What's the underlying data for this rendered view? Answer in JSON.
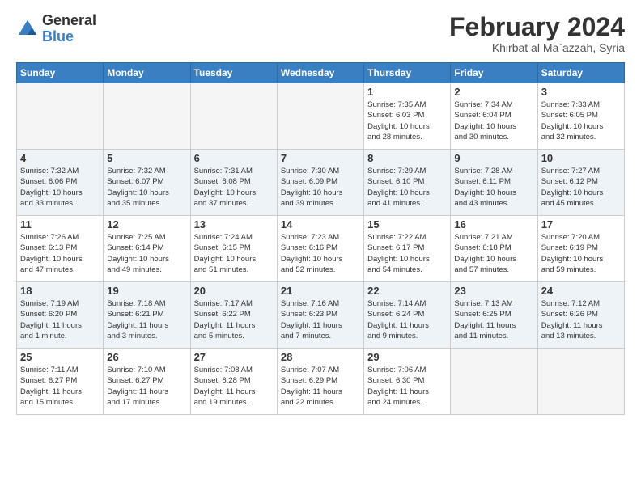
{
  "header": {
    "logo_general": "General",
    "logo_blue": "Blue",
    "title": "February 2024",
    "location": "Khirbat al Ma`azzah, Syria"
  },
  "weekdays": [
    "Sunday",
    "Monday",
    "Tuesday",
    "Wednesday",
    "Thursday",
    "Friday",
    "Saturday"
  ],
  "weeks": [
    [
      {
        "day": "",
        "info": ""
      },
      {
        "day": "",
        "info": ""
      },
      {
        "day": "",
        "info": ""
      },
      {
        "day": "",
        "info": ""
      },
      {
        "day": "1",
        "info": "Sunrise: 7:35 AM\nSunset: 6:03 PM\nDaylight: 10 hours\nand 28 minutes."
      },
      {
        "day": "2",
        "info": "Sunrise: 7:34 AM\nSunset: 6:04 PM\nDaylight: 10 hours\nand 30 minutes."
      },
      {
        "day": "3",
        "info": "Sunrise: 7:33 AM\nSunset: 6:05 PM\nDaylight: 10 hours\nand 32 minutes."
      }
    ],
    [
      {
        "day": "4",
        "info": "Sunrise: 7:32 AM\nSunset: 6:06 PM\nDaylight: 10 hours\nand 33 minutes."
      },
      {
        "day": "5",
        "info": "Sunrise: 7:32 AM\nSunset: 6:07 PM\nDaylight: 10 hours\nand 35 minutes."
      },
      {
        "day": "6",
        "info": "Sunrise: 7:31 AM\nSunset: 6:08 PM\nDaylight: 10 hours\nand 37 minutes."
      },
      {
        "day": "7",
        "info": "Sunrise: 7:30 AM\nSunset: 6:09 PM\nDaylight: 10 hours\nand 39 minutes."
      },
      {
        "day": "8",
        "info": "Sunrise: 7:29 AM\nSunset: 6:10 PM\nDaylight: 10 hours\nand 41 minutes."
      },
      {
        "day": "9",
        "info": "Sunrise: 7:28 AM\nSunset: 6:11 PM\nDaylight: 10 hours\nand 43 minutes."
      },
      {
        "day": "10",
        "info": "Sunrise: 7:27 AM\nSunset: 6:12 PM\nDaylight: 10 hours\nand 45 minutes."
      }
    ],
    [
      {
        "day": "11",
        "info": "Sunrise: 7:26 AM\nSunset: 6:13 PM\nDaylight: 10 hours\nand 47 minutes."
      },
      {
        "day": "12",
        "info": "Sunrise: 7:25 AM\nSunset: 6:14 PM\nDaylight: 10 hours\nand 49 minutes."
      },
      {
        "day": "13",
        "info": "Sunrise: 7:24 AM\nSunset: 6:15 PM\nDaylight: 10 hours\nand 51 minutes."
      },
      {
        "day": "14",
        "info": "Sunrise: 7:23 AM\nSunset: 6:16 PM\nDaylight: 10 hours\nand 52 minutes."
      },
      {
        "day": "15",
        "info": "Sunrise: 7:22 AM\nSunset: 6:17 PM\nDaylight: 10 hours\nand 54 minutes."
      },
      {
        "day": "16",
        "info": "Sunrise: 7:21 AM\nSunset: 6:18 PM\nDaylight: 10 hours\nand 57 minutes."
      },
      {
        "day": "17",
        "info": "Sunrise: 7:20 AM\nSunset: 6:19 PM\nDaylight: 10 hours\nand 59 minutes."
      }
    ],
    [
      {
        "day": "18",
        "info": "Sunrise: 7:19 AM\nSunset: 6:20 PM\nDaylight: 11 hours\nand 1 minute."
      },
      {
        "day": "19",
        "info": "Sunrise: 7:18 AM\nSunset: 6:21 PM\nDaylight: 11 hours\nand 3 minutes."
      },
      {
        "day": "20",
        "info": "Sunrise: 7:17 AM\nSunset: 6:22 PM\nDaylight: 11 hours\nand 5 minutes."
      },
      {
        "day": "21",
        "info": "Sunrise: 7:16 AM\nSunset: 6:23 PM\nDaylight: 11 hours\nand 7 minutes."
      },
      {
        "day": "22",
        "info": "Sunrise: 7:14 AM\nSunset: 6:24 PM\nDaylight: 11 hours\nand 9 minutes."
      },
      {
        "day": "23",
        "info": "Sunrise: 7:13 AM\nSunset: 6:25 PM\nDaylight: 11 hours\nand 11 minutes."
      },
      {
        "day": "24",
        "info": "Sunrise: 7:12 AM\nSunset: 6:26 PM\nDaylight: 11 hours\nand 13 minutes."
      }
    ],
    [
      {
        "day": "25",
        "info": "Sunrise: 7:11 AM\nSunset: 6:27 PM\nDaylight: 11 hours\nand 15 minutes."
      },
      {
        "day": "26",
        "info": "Sunrise: 7:10 AM\nSunset: 6:27 PM\nDaylight: 11 hours\nand 17 minutes."
      },
      {
        "day": "27",
        "info": "Sunrise: 7:08 AM\nSunset: 6:28 PM\nDaylight: 11 hours\nand 19 minutes."
      },
      {
        "day": "28",
        "info": "Sunrise: 7:07 AM\nSunset: 6:29 PM\nDaylight: 11 hours\nand 22 minutes."
      },
      {
        "day": "29",
        "info": "Sunrise: 7:06 AM\nSunset: 6:30 PM\nDaylight: 11 hours\nand 24 minutes."
      },
      {
        "day": "",
        "info": ""
      },
      {
        "day": "",
        "info": ""
      }
    ]
  ]
}
